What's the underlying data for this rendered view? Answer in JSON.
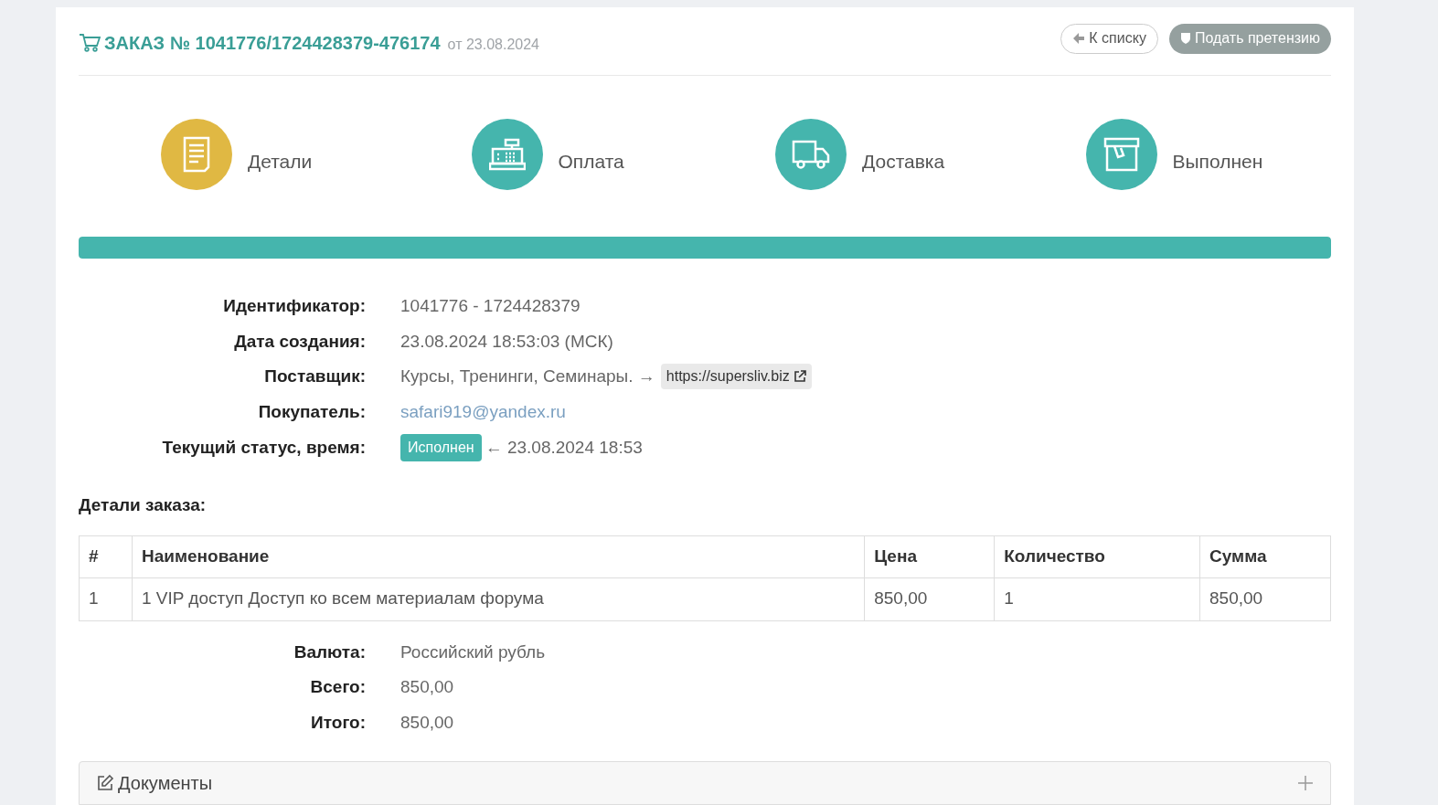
{
  "header": {
    "title": "ЗАКАЗ № 1041776/1724428379-476174",
    "date": "от 23.08.2024",
    "buttons": [
      {
        "label": "К списку",
        "kind": "back"
      },
      {
        "label": "Подать претензию",
        "kind": "claim"
      }
    ]
  },
  "steps": [
    {
      "label": "Детали",
      "kind": "details",
      "color": "#e0b843"
    },
    {
      "label": "Оплата",
      "kind": "payment",
      "color": "#45b5ad"
    },
    {
      "label": "Доставка",
      "kind": "delivery",
      "color": "#45b5ad"
    },
    {
      "label": "Выполнен",
      "kind": "done",
      "color": "#45b5ad"
    }
  ],
  "progress": {
    "level": 1
  },
  "info": [
    {
      "label": "Идентификатор:",
      "kind": "text",
      "value": "1041776 - 1724428379"
    },
    {
      "label": "Дата создания:",
      "kind": "text",
      "value": "23.08.2024 18:53:03 (МСК)"
    },
    {
      "label": "Поставщик:",
      "kind": "supplier",
      "value": "Курсы, Тренинги, Семинары. →",
      "link": "https://supersliv.biz"
    },
    {
      "label": "Покупатель:",
      "kind": "email",
      "value": "safari919@yandex.ru"
    },
    {
      "label": "Текущий статус, время:",
      "kind": "status",
      "badge": "Исполнен",
      "value": "← 23.08.2024 18:53"
    }
  ],
  "details_title": "Детали заказа:",
  "table": {
    "columns": [
      "#",
      "Наименование",
      "Цена",
      "Количество",
      "Сумма"
    ],
    "rows": [
      [
        "1",
        "1 VIP доступ Доступ ко всем материалам форума",
        "850,00",
        "1",
        "850,00"
      ]
    ]
  },
  "totals": [
    {
      "label": "Валюта:",
      "value": "Российский рубль"
    },
    {
      "label": "Всего:",
      "value": "850,00"
    },
    {
      "label": "Итого:",
      "value": "850,00"
    }
  ],
  "documents": {
    "title": "Документы"
  }
}
